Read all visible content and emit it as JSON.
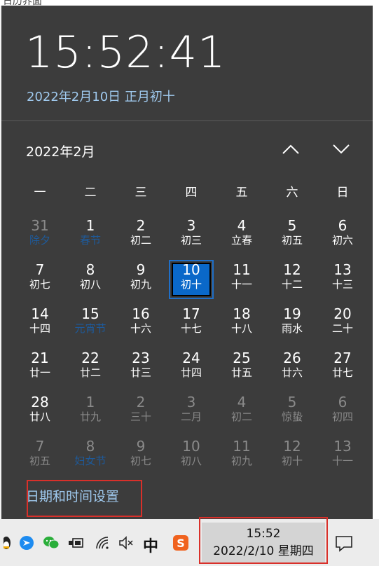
{
  "top_fragment": "日历界面",
  "clock": {
    "time": "15:52:41",
    "full_date": "2022年2月10日 正月初十"
  },
  "calendar": {
    "month_label": "2022年2月",
    "weekdays": [
      "一",
      "二",
      "三",
      "四",
      "五",
      "六",
      "日"
    ],
    "days": [
      {
        "n": "31",
        "l": "除夕",
        "s": "dimfest"
      },
      {
        "n": "1",
        "l": "春节",
        "s": "fest"
      },
      {
        "n": "2",
        "l": "初二",
        "s": ""
      },
      {
        "n": "3",
        "l": "初三",
        "s": ""
      },
      {
        "n": "4",
        "l": "立春",
        "s": ""
      },
      {
        "n": "5",
        "l": "初五",
        "s": ""
      },
      {
        "n": "6",
        "l": "初六",
        "s": ""
      },
      {
        "n": "7",
        "l": "初七",
        "s": ""
      },
      {
        "n": "8",
        "l": "初八",
        "s": ""
      },
      {
        "n": "9",
        "l": "初九",
        "s": ""
      },
      {
        "n": "10",
        "l": "初十",
        "s": "today"
      },
      {
        "n": "11",
        "l": "十一",
        "s": ""
      },
      {
        "n": "12",
        "l": "十二",
        "s": ""
      },
      {
        "n": "13",
        "l": "十三",
        "s": ""
      },
      {
        "n": "14",
        "l": "十四",
        "s": ""
      },
      {
        "n": "15",
        "l": "元宵节",
        "s": "fest"
      },
      {
        "n": "16",
        "l": "十六",
        "s": ""
      },
      {
        "n": "17",
        "l": "十七",
        "s": ""
      },
      {
        "n": "18",
        "l": "十八",
        "s": ""
      },
      {
        "n": "19",
        "l": "雨水",
        "s": ""
      },
      {
        "n": "20",
        "l": "二十",
        "s": ""
      },
      {
        "n": "21",
        "l": "廿一",
        "s": ""
      },
      {
        "n": "22",
        "l": "廿二",
        "s": ""
      },
      {
        "n": "23",
        "l": "廿三",
        "s": ""
      },
      {
        "n": "24",
        "l": "廿四",
        "s": ""
      },
      {
        "n": "25",
        "l": "廿五",
        "s": ""
      },
      {
        "n": "26",
        "l": "廿六",
        "s": ""
      },
      {
        "n": "27",
        "l": "廿七",
        "s": ""
      },
      {
        "n": "28",
        "l": "廿八",
        "s": ""
      },
      {
        "n": "1",
        "l": "廿九",
        "s": "dim"
      },
      {
        "n": "2",
        "l": "三十",
        "s": "dim"
      },
      {
        "n": "3",
        "l": "二月",
        "s": "dim"
      },
      {
        "n": "4",
        "l": "初二",
        "s": "dim"
      },
      {
        "n": "5",
        "l": "惊蛰",
        "s": "dim"
      },
      {
        "n": "6",
        "l": "初四",
        "s": "dim"
      },
      {
        "n": "7",
        "l": "初五",
        "s": "dim"
      },
      {
        "n": "8",
        "l": "妇女节",
        "s": "dimfest"
      },
      {
        "n": "9",
        "l": "初七",
        "s": "dim"
      },
      {
        "n": "10",
        "l": "初八",
        "s": "dim"
      },
      {
        "n": "11",
        "l": "初九",
        "s": "dim"
      },
      {
        "n": "12",
        "l": "初十",
        "s": "dim"
      },
      {
        "n": "13",
        "l": "十一",
        "s": "dim"
      }
    ]
  },
  "settings_link": "日期和时间设置",
  "taskbar": {
    "tray_time": "15:52",
    "tray_date": "2022/2/10 星期四",
    "ime_label": "中",
    "icons": [
      "qq-icon",
      "feishu-icon",
      "wechat-icon",
      "usb-icon",
      "battery-icon",
      "wifi-icon",
      "volume-muted-icon",
      "sogou-icon",
      "notification-icon"
    ]
  },
  "colors": {
    "flyout_bg": "#3c3c3c",
    "accent": "#0a68c9",
    "link": "#9fc9ee",
    "highlight_box": "#d9302a"
  }
}
